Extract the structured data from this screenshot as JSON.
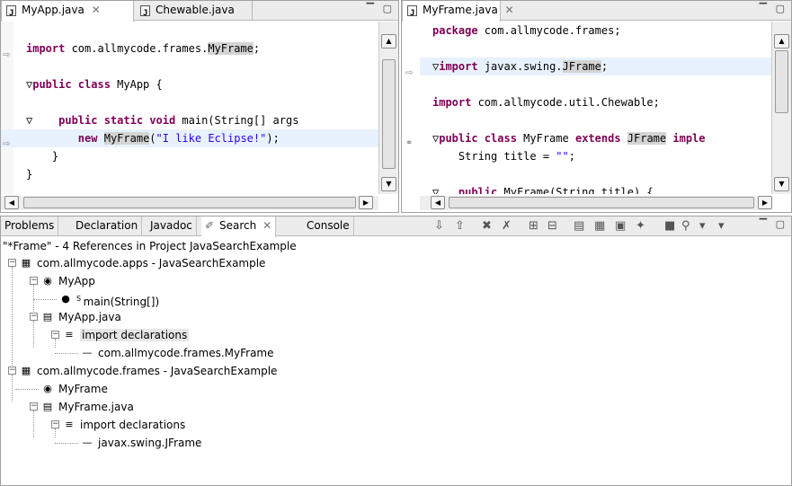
{
  "left_editor": {
    "tabs": [
      "MyApp.java",
      "Chewable.java"
    ],
    "lines": [
      {
        "segments": [
          [
            "plain",
            ""
          ]
        ]
      },
      {
        "segments": [
          [
            "kw",
            "import"
          ],
          [
            "plain",
            " com.allmycode.frames."
          ],
          [
            "mark",
            "MyFrame"
          ],
          [
            "plain",
            ";"
          ]
        ]
      },
      {
        "segments": [
          [
            "plain",
            ""
          ]
        ]
      },
      {
        "segments": [
          [
            "plain",
            "▽"
          ],
          [
            "kw",
            "public class"
          ],
          [
            "plain",
            " MyApp {"
          ]
        ]
      },
      {
        "segments": [
          [
            "plain",
            ""
          ]
        ]
      },
      {
        "segments": [
          [
            "plain",
            "▽    "
          ],
          [
            "kw",
            "public static void"
          ],
          [
            "plain",
            " main(String[] args"
          ]
        ]
      },
      {
        "segments": [
          [
            "plain",
            "        "
          ],
          [
            "kw",
            "new"
          ],
          [
            "plain",
            " "
          ],
          [
            "mark",
            "MyFrame"
          ],
          [
            "plain",
            "("
          ],
          [
            "str",
            "\"I like Eclipse!\""
          ],
          [
            "plain",
            ");"
          ]
        ]
      },
      {
        "segments": [
          [
            "plain",
            "    }"
          ]
        ]
      },
      {
        "segments": [
          [
            "plain",
            "}"
          ]
        ]
      }
    ]
  },
  "right_editor": {
    "tabs": [
      "MyFrame.java"
    ],
    "lines": [
      {
        "segments": [
          [
            "kw",
            "package"
          ],
          [
            "plain",
            " com.allmycode.frames;"
          ]
        ]
      },
      {
        "segments": [
          [
            "plain",
            ""
          ]
        ]
      },
      {
        "segments": [
          [
            "plain",
            "▽"
          ],
          [
            "kw",
            "import"
          ],
          [
            "plain",
            " javax.swing."
          ],
          [
            "mark",
            "JFrame"
          ],
          [
            "plain",
            ";"
          ]
        ]
      },
      {
        "segments": [
          [
            "plain",
            ""
          ]
        ]
      },
      {
        "segments": [
          [
            "kw",
            "import"
          ],
          [
            "plain",
            " com.allmycode.util.Chewable;"
          ]
        ]
      },
      {
        "segments": [
          [
            "plain",
            ""
          ]
        ]
      },
      {
        "segments": [
          [
            "plain",
            "▽"
          ],
          [
            "kw",
            "public class"
          ],
          [
            "plain",
            " MyFrame "
          ],
          [
            "kw",
            "extends"
          ],
          [
            "plain",
            " "
          ],
          [
            "mark",
            "JFrame"
          ],
          [
            "plain",
            " "
          ],
          [
            "kw",
            "imple"
          ]
        ]
      },
      {
        "segments": [
          [
            "plain",
            "    String title = "
          ],
          [
            "str",
            "\"\""
          ],
          [
            "plain",
            ";"
          ]
        ]
      },
      {
        "segments": [
          [
            "plain",
            ""
          ]
        ]
      },
      {
        "segments": [
          [
            "plain",
            "▽   "
          ],
          [
            "kw",
            "public"
          ],
          [
            "plain",
            " MyFrame(String title) {"
          ]
        ]
      }
    ]
  },
  "bottom": {
    "tabs": [
      "Problems",
      "Declaration",
      "Javadoc",
      "Search",
      "Console"
    ],
    "summary": "\"*Frame\" - 4 References in Project JavaSearchExample",
    "tree": [
      {
        "label": "com.allmycode.apps - JavaSearchExample",
        "icon": "package-icon",
        "glyph": "▦",
        "sel": false
      },
      {
        "label": "MyApp",
        "icon": "class-icon",
        "glyph": "◉",
        "sel": false
      },
      {
        "label": "main(String[])",
        "icon": "method-icon",
        "glyph": "●",
        "sel": false,
        "sup": "S"
      },
      {
        "label": "MyApp.java",
        "icon": "java-file-icon",
        "glyph": "▤",
        "sel": false
      },
      {
        "label": "import declarations",
        "icon": "imports-icon",
        "glyph": "≡",
        "sel": true
      },
      {
        "label": "com.allmycode.frames.MyFrame",
        "icon": "import-icon",
        "glyph": "—",
        "sel": false
      },
      {
        "label": "com.allmycode.frames - JavaSearchExample",
        "icon": "package-icon",
        "glyph": "▦",
        "sel": false
      },
      {
        "label": "MyFrame",
        "icon": "class-icon",
        "glyph": "◉",
        "sel": false
      },
      {
        "label": "MyFrame.java",
        "icon": "java-file-icon",
        "glyph": "▤",
        "sel": false
      },
      {
        "label": "import declarations",
        "icon": "imports-icon",
        "glyph": "≡",
        "sel": false
      },
      {
        "label": "javax.swing.JFrame",
        "icon": "import-icon",
        "glyph": "—",
        "sel": false
      }
    ]
  }
}
